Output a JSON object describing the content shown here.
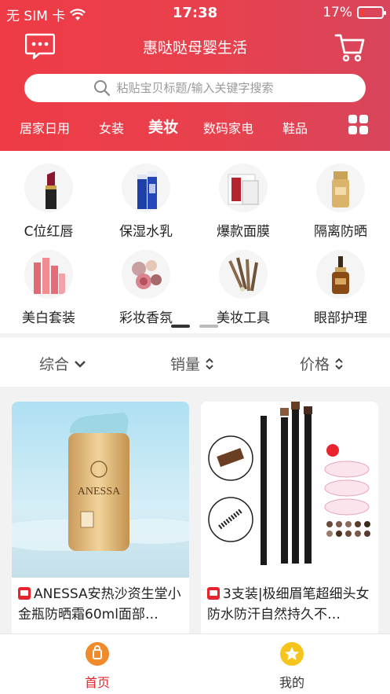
{
  "status_bar": {
    "carrier": "无 SIM 卡",
    "time": "17:38",
    "battery": "17%",
    "battery_level": 0.17
  },
  "header": {
    "title": "惠哒哒母婴生活",
    "chat_icon": "chat-bubble-icon",
    "cart_icon": "shopping-cart-icon"
  },
  "search": {
    "placeholder": "粘贴宝贝标题/输入关键字搜索"
  },
  "categories": [
    "居家日用",
    "女装",
    "美妆",
    "数码家电",
    "鞋品"
  ],
  "active_category": "美妆",
  "subcategories": [
    {
      "label": "C位红唇",
      "icon": "lipstick-icon"
    },
    {
      "label": "保湿水乳",
      "icon": "lotion-bottles-icon"
    },
    {
      "label": "爆款面膜",
      "icon": "face-mask-box-icon"
    },
    {
      "label": "隔离防晒",
      "icon": "sunscreen-bottle-icon"
    },
    {
      "label": "美白套装",
      "icon": "skincare-set-icon"
    },
    {
      "label": "彩妆香氛",
      "icon": "makeup-palette-icon"
    },
    {
      "label": "美妆工具",
      "icon": "makeup-brushes-icon"
    },
    {
      "label": "眼部护理",
      "icon": "eye-serum-icon"
    }
  ],
  "sort": {
    "comprehensive": "综合",
    "sales": "销量",
    "price": "价格"
  },
  "products": [
    {
      "title": "ANESSA安热沙资生堂小金瓶防晒霜60ml面部…",
      "badge": "tmall-icon",
      "image": "sunscreen-product-image"
    },
    {
      "title": "3支装|极细眉笔超细头女防水防汗自然持久不…",
      "badge": "tmall-icon",
      "image": "eyebrow-pencil-product-image"
    }
  ],
  "tabbar": {
    "home": "首页",
    "mine": "我的"
  },
  "colors": {
    "brand_red": "#ee3b45",
    "active_tab": "#e8232d",
    "home_icon": "#f08a2a",
    "mine_icon": "#f5c51d"
  }
}
